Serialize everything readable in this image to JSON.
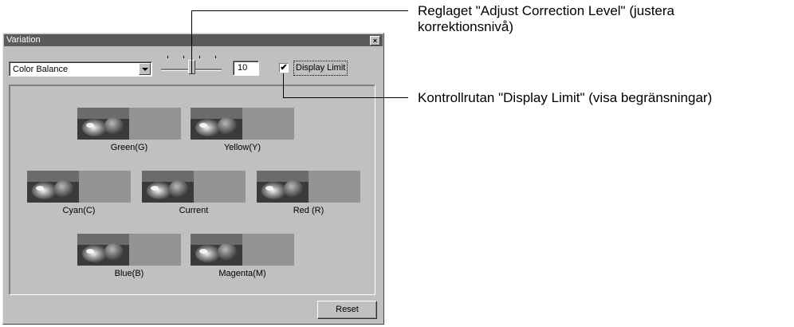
{
  "window": {
    "title": "Variation",
    "close_glyph": "×"
  },
  "controls": {
    "dropdown_value": "Color Balance",
    "slider_level": 10,
    "level_value": "10",
    "display_limit_checked": true,
    "display_limit_label": "Display Limit",
    "check_glyph": "✔"
  },
  "variations": [
    {
      "label": "Green(G)",
      "row": 0,
      "col": 0
    },
    {
      "label": "Yellow(Y)",
      "row": 0,
      "col": 1
    },
    {
      "label": "Cyan(C)",
      "row": 1,
      "col": 0
    },
    {
      "label": "Current",
      "row": 1,
      "col": 1
    },
    {
      "label": "Red (R)",
      "row": 1,
      "col": 2
    },
    {
      "label": "Blue(B)",
      "row": 2,
      "col": 0
    },
    {
      "label": "Magenta(M)",
      "row": 2,
      "col": 1
    }
  ],
  "reset_label": "Reset",
  "callouts": {
    "slider": "Reglaget \"Adjust Correction Level\" (justera korrektionsnivå)",
    "checkbox": "Kontrollrutan \"Display Limit\" (visa begränsningar)"
  }
}
